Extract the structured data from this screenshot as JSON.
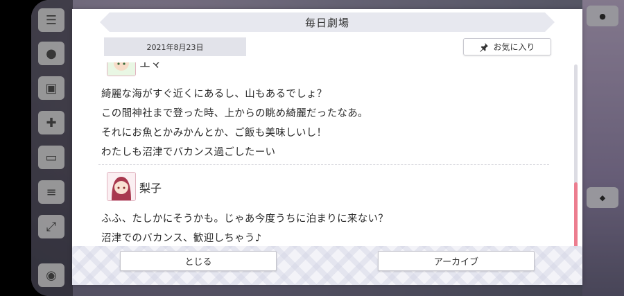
{
  "header": {
    "title": "毎日劇場"
  },
  "date_chip": "2021年8月23日",
  "favorite_button": {
    "label": "お気に入り",
    "icon": "pin-icon"
  },
  "entries": [
    {
      "speaker": "エマ",
      "avatar_icon": "emma-avatar-icon",
      "lines": [
        "綺麗な海がすぐ近くにあるし、山もあるでしょ？",
        "この間神社まで登った時、上からの眺め綺麗だったなあ。",
        "それにお魚とかみかんとか、ご飯も美味しいし！",
        "わたしも沼津でバカンス過ごしたーい"
      ]
    },
    {
      "speaker": "梨子",
      "avatar_icon": "riko-avatar-icon",
      "lines": [
        "ふふ、たしかにそうかも。じゃあ今度うちに泊まりに来ない？",
        "沼津でのバカンス、歓迎しちゃう♪"
      ]
    }
  ],
  "footer": {
    "close_label": "とじる",
    "archive_label": "アーカイブ"
  },
  "scroll": {
    "position_fraction": 0.62
  },
  "colors": {
    "accent": "#ec7d8f",
    "header_bg": "#e7e8ef"
  }
}
